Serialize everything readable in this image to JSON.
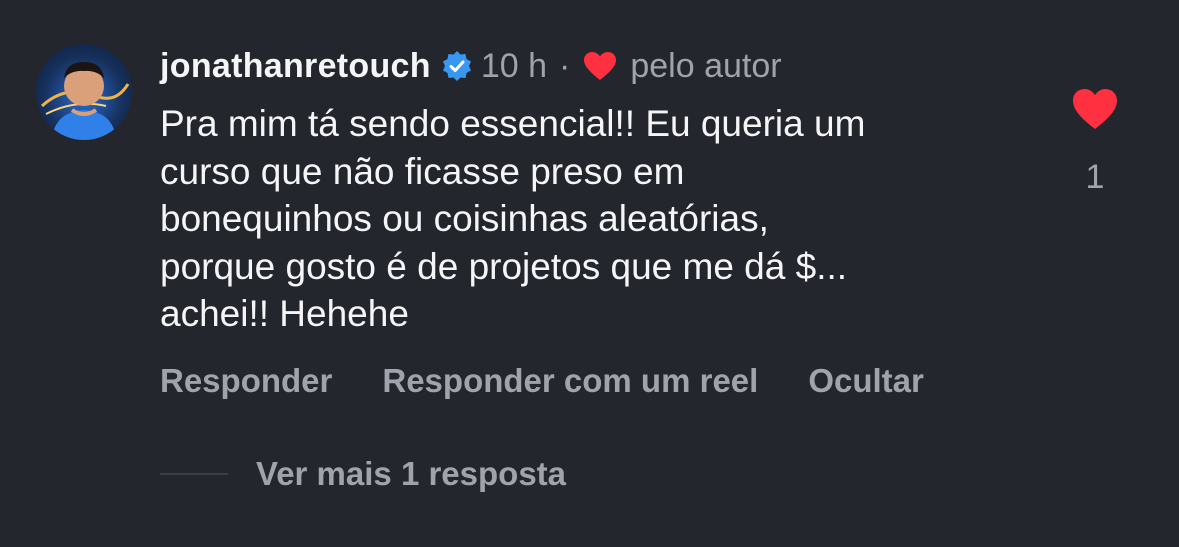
{
  "comment": {
    "username": "jonathanretouch",
    "time": "10 h",
    "separator": "·",
    "author_liked_label": "pelo autor",
    "text_lines": [
      "Pra mim tá sendo essencial!! Eu queria um",
      "curso que não ficasse preso em",
      "bonequinhos ou coisinhas aleatórias,",
      "porque gosto é de projetos que me dá $...",
      "achei!! Hehehe"
    ],
    "like_count": "1",
    "liked": true
  },
  "actions": {
    "reply": "Responder",
    "reply_reel": "Responder com um reel",
    "hide": "Ocultar"
  },
  "replies": {
    "label": "Ver mais 1 resposta"
  },
  "colors": {
    "background": "#24262e",
    "text_primary": "#f5f5f7",
    "text_secondary": "#a0a3ab",
    "heart_red": "#ff3040",
    "verified_blue": "#3897f0"
  },
  "icons": {
    "verified": "verified-badge-icon",
    "author_heart": "heart-icon",
    "like": "heart-filled-icon"
  }
}
